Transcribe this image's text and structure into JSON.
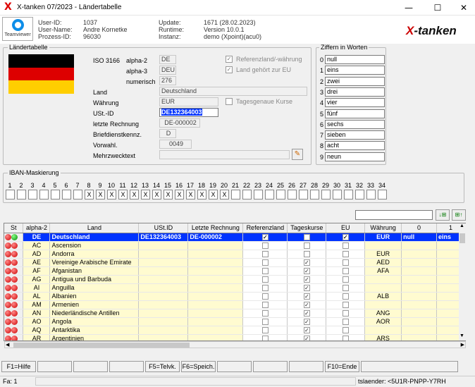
{
  "window": {
    "title": "X-tanken 07/2023 - Ländertabelle",
    "minimize": "—",
    "maximize": "☐",
    "close": "✕"
  },
  "header": {
    "teamviewer": "Teamviewer",
    "labels": [
      "User-ID:",
      "User-Name:",
      "Prozess-ID:"
    ],
    "values": [
      "1037",
      "Andre Kornetke",
      "96030"
    ],
    "labels2": [
      "Update:",
      "Runtime:",
      "Instanz:"
    ],
    "values2": [
      "1671 (28.02.2023)",
      "Version 10.0.1",
      "demo (Xpoint)(acu0)"
    ],
    "brand_x": "X",
    "brand_rest": "-tanken"
  },
  "laender": {
    "group_title": "Ländertabelle",
    "iso_label": "ISO 3166",
    "alpha2_label": "alpha-2",
    "alpha2": "DE",
    "alpha3_label": "alpha-3",
    "alpha3": "DEU",
    "numerisch_label": "numerisch",
    "numerisch": "276",
    "ref_label": "Referenzland/-währung",
    "eu_label": "Land gehört zur EU",
    "land_label": "Land",
    "land": "Deutschland",
    "waehrung_label": "Währung",
    "waehrung": "EUR",
    "tageskurse_label": "Tagesgenaue Kurse",
    "ustid_label": "USt.-ID",
    "ustid": "DE132364003",
    "rechnung_label": "letzte Rechnung",
    "rechnung": "DE-000002",
    "brief_label": "Briefdienstkennz.",
    "brief": "D",
    "vorwahl_label": "Vorwahl.",
    "vorwahl": "0049",
    "mehrzweck_label": "Mehrzwecktext",
    "mehrzweck": ""
  },
  "ziffern": {
    "title": "Ziffern in Worten",
    "nums": [
      "0",
      "1",
      "2",
      "3",
      "4",
      "5",
      "6",
      "7",
      "8",
      "9"
    ],
    "words": [
      "null",
      "eins",
      "zwei",
      "drei",
      "vier",
      "fünf",
      "sechs",
      "sieben",
      "acht",
      "neun"
    ]
  },
  "iban": {
    "title": "IBAN-Maskierung",
    "nums": [
      "1",
      "2",
      "3",
      "4",
      "5",
      "6",
      "7",
      "8",
      "9",
      "10",
      "11",
      "12",
      "13",
      "14",
      "15",
      "16",
      "17",
      "18",
      "19",
      "20",
      "21",
      "22",
      "23",
      "24",
      "25",
      "26",
      "27",
      "28",
      "29",
      "30",
      "31",
      "32",
      "33",
      "34"
    ],
    "vals": [
      "",
      "",
      "",
      "",
      "",
      "",
      "",
      "X",
      "X",
      "X",
      "X",
      "X",
      "X",
      "X",
      "X",
      "X",
      "X",
      "X",
      "X",
      "X",
      "",
      "",
      "",
      "",
      "",
      "",
      "",
      "",
      "",
      "",
      "",
      "",
      "",
      ""
    ]
  },
  "table": {
    "headers": [
      "St",
      "alpha-2",
      "Land",
      "USt.ID",
      "Letzte Rechnung",
      "Referenzland",
      "Tageskurse",
      "EU",
      "Währung",
      "0",
      "1"
    ],
    "rows": [
      {
        "a": "DE",
        "land": "Deutschland",
        "ust": "DE132364003",
        "rech": "DE-000002",
        "ref": "✓",
        "tk": "",
        "eu": "✓",
        "w": "EUR",
        "z0": "null",
        "z1": "eins"
      },
      {
        "a": "AC",
        "land": "Ascension",
        "ust": "",
        "rech": "",
        "ref": "",
        "tk": "",
        "eu": "",
        "w": "",
        "z0": "",
        "z1": ""
      },
      {
        "a": "AD",
        "land": "Andorra",
        "ust": "",
        "rech": "",
        "ref": "",
        "tk": "",
        "eu": "",
        "w": "EUR",
        "z0": "",
        "z1": ""
      },
      {
        "a": "AE",
        "land": "Vereinige Arabische Emirate",
        "ust": "",
        "rech": "",
        "ref": "",
        "tk": "✓",
        "eu": "",
        "w": "AED",
        "z0": "",
        "z1": ""
      },
      {
        "a": "AF",
        "land": "Afganistan",
        "ust": "",
        "rech": "",
        "ref": "",
        "tk": "✓",
        "eu": "",
        "w": "AFA",
        "z0": "",
        "z1": ""
      },
      {
        "a": "AG",
        "land": "Antigua und Barbuda",
        "ust": "",
        "rech": "",
        "ref": "",
        "tk": "✓",
        "eu": "",
        "w": "",
        "z0": "",
        "z1": ""
      },
      {
        "a": "AI",
        "land": "Anguilla",
        "ust": "",
        "rech": "",
        "ref": "",
        "tk": "✓",
        "eu": "",
        "w": "",
        "z0": "",
        "z1": ""
      },
      {
        "a": "AL",
        "land": "Albanien",
        "ust": "",
        "rech": "",
        "ref": "",
        "tk": "✓",
        "eu": "",
        "w": "ALB",
        "z0": "",
        "z1": ""
      },
      {
        "a": "AM",
        "land": "Armenien",
        "ust": "",
        "rech": "",
        "ref": "",
        "tk": "✓",
        "eu": "",
        "w": "",
        "z0": "",
        "z1": ""
      },
      {
        "a": "AN",
        "land": "Niederländische Antillen",
        "ust": "",
        "rech": "",
        "ref": "",
        "tk": "✓",
        "eu": "",
        "w": "ANG",
        "z0": "",
        "z1": ""
      },
      {
        "a": "AO",
        "land": "Angola",
        "ust": "",
        "rech": "",
        "ref": "",
        "tk": "✓",
        "eu": "",
        "w": "AOR",
        "z0": "",
        "z1": ""
      },
      {
        "a": "AQ",
        "land": "Antarktika",
        "ust": "",
        "rech": "",
        "ref": "",
        "tk": "✓",
        "eu": "",
        "w": "",
        "z0": "",
        "z1": ""
      },
      {
        "a": "AR",
        "land": "Argentinien",
        "ust": "",
        "rech": "",
        "ref": "",
        "tk": "✓",
        "eu": "",
        "w": "ARS",
        "z0": "",
        "z1": ""
      }
    ]
  },
  "fkeys": [
    "F1=Hilfe",
    "",
    "",
    "",
    "F5=Telvk.",
    "F6=Speich.",
    "",
    "",
    "",
    "F10=Ende",
    ""
  ],
  "status": {
    "left": "Fa: 1",
    "right": "tslaender: <5U1R-PNPP-Y7RH"
  }
}
